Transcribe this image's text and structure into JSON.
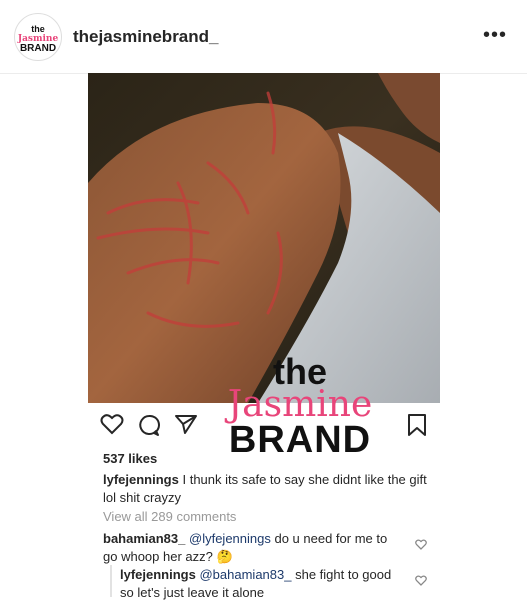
{
  "header": {
    "avatar_text": [
      "the",
      "Jasmine",
      "BRAND"
    ],
    "username": "thejasminebrand_",
    "more": "•••"
  },
  "watermark": {
    "line1": "the",
    "line2": "Jasmine",
    "line3": "BRAND"
  },
  "post": {
    "likes": "537 likes",
    "caption_user": "lyfejennings",
    "caption_text": "I thunk its safe to say she didnt like the gift lol shit crayzy",
    "view_all": "View all 289 comments"
  },
  "comments": [
    {
      "user": "bahamian83_",
      "mention": "@lyfejennings",
      "text": "do u need for me to go whoop her azz?",
      "emoji": "🤔"
    },
    {
      "user": "lyfejennings",
      "mention": "@bahamian83_",
      "text": "she fight to good so let's just leave it alone"
    }
  ],
  "icons": [
    "heart-icon",
    "comment-icon",
    "share-icon",
    "bookmark-icon",
    "more-icon"
  ]
}
